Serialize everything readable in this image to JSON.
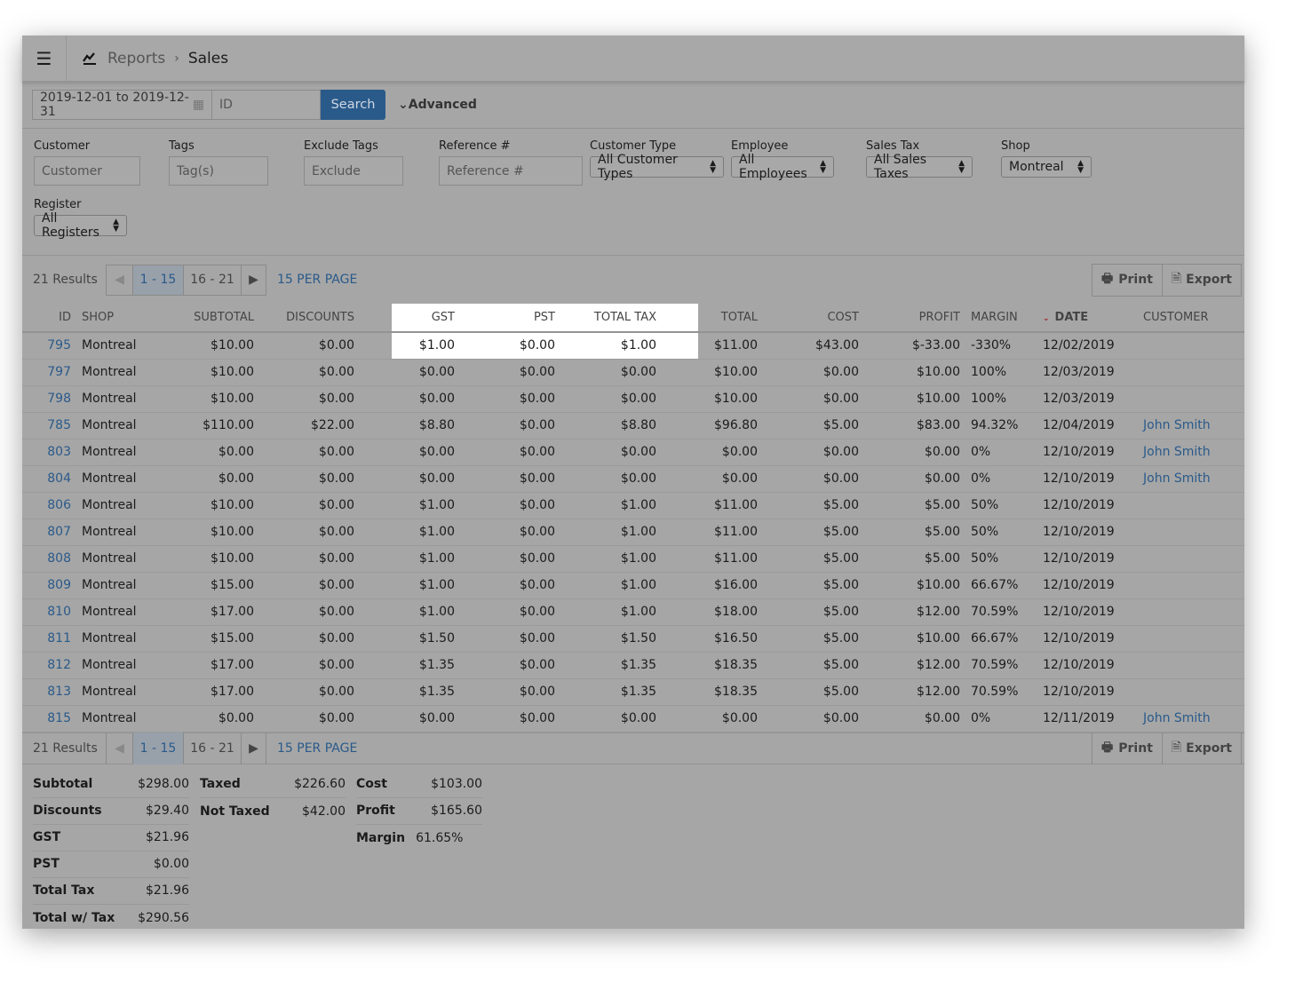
{
  "header": {
    "parent": "Reports",
    "title": "Sales",
    "icon": "line-chart-icon"
  },
  "search": {
    "date_range": "2019-12-01 to 2019-12-31",
    "id_placeholder": "ID",
    "search_label": "Search",
    "advanced_label": "Advanced"
  },
  "filters": {
    "customer": {
      "label": "Customer",
      "placeholder": "Customer"
    },
    "tags": {
      "label": "Tags",
      "placeholder": "Tag(s)"
    },
    "exclude_tags": {
      "label": "Exclude Tags",
      "placeholder": "Exclude"
    },
    "reference": {
      "label": "Reference #",
      "placeholder": "Reference #"
    },
    "customer_type": {
      "label": "Customer Type",
      "value": "All Customer Types"
    },
    "employee": {
      "label": "Employee",
      "value": "All Employees"
    },
    "sales_tax": {
      "label": "Sales Tax",
      "value": "All Sales Taxes"
    },
    "shop": {
      "label": "Shop",
      "value": "Montreal"
    },
    "register": {
      "label": "Register",
      "value": "All Registers"
    }
  },
  "pagination": {
    "results": "21 Results",
    "pages": [
      "1 - 15",
      "16 - 21"
    ],
    "current": "1 - 15",
    "per_page": "15 PER PAGE",
    "print": "Print",
    "export": "Export"
  },
  "table": {
    "columns": [
      "ID",
      "SHOP",
      "SUBTOTAL",
      "DISCOUNTS",
      "GST",
      "PST",
      "TOTAL TAX",
      "TOTAL",
      "COST",
      "PROFIT",
      "MARGIN",
      "DATE",
      "CUSTOMER"
    ],
    "sorted_by": "DATE",
    "rows": [
      [
        "795",
        "Montreal",
        "$10.00",
        "$0.00",
        "$1.00",
        "$0.00",
        "$1.00",
        "$11.00",
        "$43.00",
        "$-33.00",
        "-330%",
        "12/02/2019",
        ""
      ],
      [
        "797",
        "Montreal",
        "$10.00",
        "$0.00",
        "$0.00",
        "$0.00",
        "$0.00",
        "$10.00",
        "$0.00",
        "$10.00",
        "100%",
        "12/03/2019",
        ""
      ],
      [
        "798",
        "Montreal",
        "$10.00",
        "$0.00",
        "$0.00",
        "$0.00",
        "$0.00",
        "$10.00",
        "$0.00",
        "$10.00",
        "100%",
        "12/03/2019",
        ""
      ],
      [
        "785",
        "Montreal",
        "$110.00",
        "$22.00",
        "$8.80",
        "$0.00",
        "$8.80",
        "$96.80",
        "$5.00",
        "$83.00",
        "94.32%",
        "12/04/2019",
        "John Smith"
      ],
      [
        "803",
        "Montreal",
        "$0.00",
        "$0.00",
        "$0.00",
        "$0.00",
        "$0.00",
        "$0.00",
        "$0.00",
        "$0.00",
        "0%",
        "12/10/2019",
        "John Smith"
      ],
      [
        "804",
        "Montreal",
        "$0.00",
        "$0.00",
        "$0.00",
        "$0.00",
        "$0.00",
        "$0.00",
        "$0.00",
        "$0.00",
        "0%",
        "12/10/2019",
        "John Smith"
      ],
      [
        "806",
        "Montreal",
        "$10.00",
        "$0.00",
        "$1.00",
        "$0.00",
        "$1.00",
        "$11.00",
        "$5.00",
        "$5.00",
        "50%",
        "12/10/2019",
        ""
      ],
      [
        "807",
        "Montreal",
        "$10.00",
        "$0.00",
        "$1.00",
        "$0.00",
        "$1.00",
        "$11.00",
        "$5.00",
        "$5.00",
        "50%",
        "12/10/2019",
        ""
      ],
      [
        "808",
        "Montreal",
        "$10.00",
        "$0.00",
        "$1.00",
        "$0.00",
        "$1.00",
        "$11.00",
        "$5.00",
        "$5.00",
        "50%",
        "12/10/2019",
        ""
      ],
      [
        "809",
        "Montreal",
        "$15.00",
        "$0.00",
        "$1.00",
        "$0.00",
        "$1.00",
        "$16.00",
        "$5.00",
        "$10.00",
        "66.67%",
        "12/10/2019",
        ""
      ],
      [
        "810",
        "Montreal",
        "$17.00",
        "$0.00",
        "$1.00",
        "$0.00",
        "$1.00",
        "$18.00",
        "$5.00",
        "$12.00",
        "70.59%",
        "12/10/2019",
        ""
      ],
      [
        "811",
        "Montreal",
        "$15.00",
        "$0.00",
        "$1.50",
        "$0.00",
        "$1.50",
        "$16.50",
        "$5.00",
        "$10.00",
        "66.67%",
        "12/10/2019",
        ""
      ],
      [
        "812",
        "Montreal",
        "$17.00",
        "$0.00",
        "$1.35",
        "$0.00",
        "$1.35",
        "$18.35",
        "$5.00",
        "$12.00",
        "70.59%",
        "12/10/2019",
        ""
      ],
      [
        "813",
        "Montreal",
        "$17.00",
        "$0.00",
        "$1.35",
        "$0.00",
        "$1.35",
        "$18.35",
        "$5.00",
        "$12.00",
        "70.59%",
        "12/10/2019",
        ""
      ],
      [
        "815",
        "Montreal",
        "$0.00",
        "$0.00",
        "$0.00",
        "$0.00",
        "$0.00",
        "$0.00",
        "$0.00",
        "$0.00",
        "0%",
        "12/11/2019",
        "John Smith"
      ]
    ]
  },
  "summary": [
    [
      [
        "Subtotal",
        "$298.00"
      ],
      [
        "Discounts",
        "$29.40"
      ],
      [
        "GST",
        "$21.96"
      ],
      [
        "PST",
        "$0.00"
      ],
      [
        "Total Tax",
        "$21.96"
      ],
      [
        "Total w/ Tax",
        "$290.56"
      ]
    ],
    [
      [
        "Taxed",
        "$226.60"
      ],
      [
        "Not Taxed",
        "$42.00"
      ]
    ],
    [
      [
        "Cost",
        "$103.00"
      ],
      [
        "Profit",
        "$165.60"
      ],
      [
        "Margin",
        "61.65%"
      ]
    ]
  ],
  "colors": {
    "link": "#2a5a8a",
    "search_button": "#2a5a8a",
    "overlay": "#a6a6a6",
    "sort_indicator": "#a02020"
  }
}
